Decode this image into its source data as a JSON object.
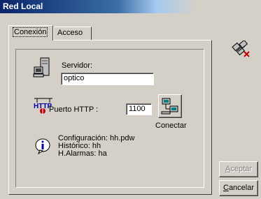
{
  "window": {
    "title": "Red Local"
  },
  "tabs": [
    {
      "label": "Conexión",
      "active": true
    },
    {
      "label": "Acceso",
      "active": false
    }
  ],
  "form": {
    "server_label": "Servidor:",
    "server_value": "optico",
    "port_label": "Puerto HTTP :",
    "port_value": "1100",
    "connect_label": "Conectar"
  },
  "info": {
    "line1": "Configuración: hh.pdw",
    "line2": "Histórico: hh",
    "line3": "H.Alarmas: ha"
  },
  "buttons": {
    "accept_first": "A",
    "accept_rest": "ceptar",
    "cancel_first": "C",
    "cancel_rest": "ancelar"
  },
  "icons": {
    "server": "server-computer-icon",
    "http": "http-icon",
    "connect": "network-computers-icon",
    "info": "info-icon",
    "network": "network-disconnected-icon"
  }
}
